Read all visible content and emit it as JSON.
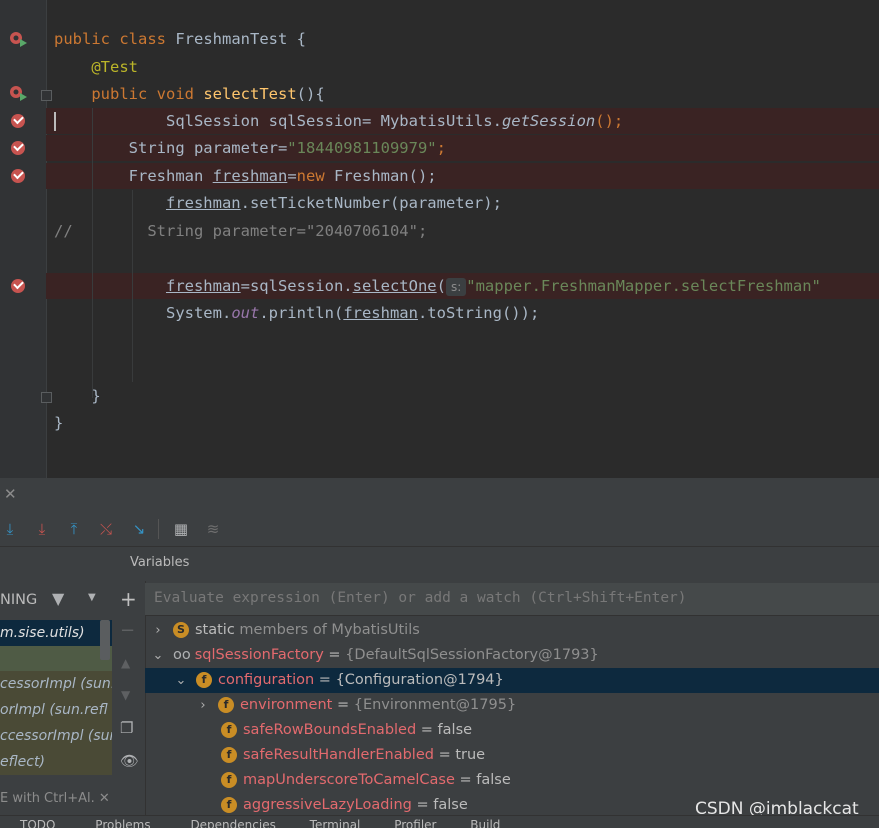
{
  "editor": {
    "lines": {
      "l1": {
        "kw": "public class",
        "name": "FreshmanTest",
        "brace": "{"
      },
      "l2": {
        "annotation": "@Test"
      },
      "l3": {
        "kw": "public void",
        "fn": "selectTest",
        "rest": "(){"
      },
      "l4": {
        "pre": "SqlSession sqlSession= MybatisUtils.",
        "call": "getSession",
        "post": "();"
      },
      "l5": {
        "pre": "String parameter=",
        "str": "\"18440981109979\"",
        "semi": ";"
      },
      "l6": {
        "pre": "Freshman ",
        "var": "freshman",
        "eq": "=",
        "kw": "new",
        "post": " Freshman();"
      },
      "l7": {
        "var": "freshman",
        "post": ".setTicketNumber(parameter);"
      },
      "l8": {
        "comment": "//        String parameter=\"2040706104\";"
      },
      "l9": {
        "var": "freshman",
        "mid": "=sqlSession.",
        "call": "selectOne",
        "paren": "(",
        "hint": "s:",
        "str": "\"mapper.FreshmanMapper.selectFreshman\""
      },
      "l10": {
        "pre": "System.",
        "field": "out",
        "mid": ".println(",
        "var": "freshman",
        "post": ".toString());"
      },
      "l11": {
        "text": "}"
      },
      "l12": {
        "text": "}"
      }
    }
  },
  "toolbar": {
    "icons": [
      "step-over-icon",
      "step-into-icon",
      "force-step-into-icon",
      "step-out-icon",
      "drop-frame-icon",
      "run-to-cursor-icon",
      "evaluate-expression-icon",
      "trace-icon"
    ]
  },
  "frames": {
    "header": "NING",
    "items": [
      {
        "label": "m.sise.utils)",
        "selected": true
      },
      {
        "label": "",
        "selected": false
      },
      {
        "label": "cessorImpl (sun.refl",
        "selected": false
      },
      {
        "label": "orImpl (sun.refl",
        "selected": false
      },
      {
        "label": "ccessorImpl (sun",
        "selected": false
      },
      {
        "label": "eflect)",
        "selected": false
      }
    ],
    "hint": "E with Ctrl+Al."
  },
  "variables": {
    "title": "Variables",
    "eval_placeholder": "Evaluate expression (Enter) or add a watch (Ctrl+Shift+Enter)",
    "rows": [
      {
        "name": "static",
        "rest": " members of MybatisUtils"
      },
      {
        "name": "sqlSessionFactory",
        "eq": " = ",
        "value": "{DefaultSqlSessionFactory@1793}"
      },
      {
        "name": "configuration",
        "eq": " = ",
        "value": "{Configuration@1794}"
      },
      {
        "name": "environment",
        "eq": " = ",
        "value": "{Environment@1795}"
      },
      {
        "name": "safeRowBoundsEnabled",
        "eq": " = ",
        "value": "false"
      },
      {
        "name": "safeResultHandlerEnabled",
        "eq": " = ",
        "value": "true"
      },
      {
        "name": "mapUnderscoreToCamelCase",
        "eq": " = ",
        "value": "false"
      },
      {
        "name": "aggressiveLazyLoading",
        "eq": " = ",
        "value": "false"
      }
    ]
  },
  "statusbar": {
    "tabs": [
      "TODO",
      "Problems",
      "Dependencies",
      "Terminal",
      "Profiler",
      "Build"
    ]
  },
  "watermark": "CSDN @imblackcat",
  "colors": {
    "breakpoint": "#c75450",
    "selection": "#0d293e",
    "field_badge": "#c98d25"
  }
}
